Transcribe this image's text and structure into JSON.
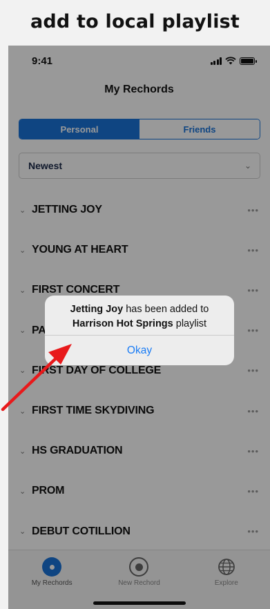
{
  "caption": "add to local playlist",
  "status_bar": {
    "time": "9:41"
  },
  "nav": {
    "title": "My Rechords"
  },
  "segments": [
    {
      "label": "Personal",
      "active": true
    },
    {
      "label": "Friends",
      "active": false
    }
  ],
  "sort": {
    "value": "Newest"
  },
  "list": [
    {
      "title": "JETTING JOY"
    },
    {
      "title": "YOUNG AT HEART"
    },
    {
      "title": "FIRST CONCERT"
    },
    {
      "title": "PA"
    },
    {
      "title": "FIRST DAY OF COLLEGE"
    },
    {
      "title": "FIRST TIME SKYDIVING"
    },
    {
      "title": "HS GRADUATION"
    },
    {
      "title": "PROM"
    },
    {
      "title": "DEBUT COTILLION"
    }
  ],
  "more_glyph": "•••",
  "tabs": [
    {
      "label": "My Rechords",
      "icon": "record-icon",
      "active": true
    },
    {
      "label": "New Rechord",
      "icon": "new-record-icon",
      "active": false
    },
    {
      "label": "Explore",
      "icon": "globe-icon",
      "active": false
    }
  ],
  "alert": {
    "song": "Jetting Joy",
    "line1_suffix": "has been added to",
    "playlist": "Harrison Hot Springs",
    "line2_suffix": "playlist",
    "button": "Okay"
  },
  "colors": {
    "accent": "#1a73d9",
    "annotation_arrow": "#e8191b"
  }
}
